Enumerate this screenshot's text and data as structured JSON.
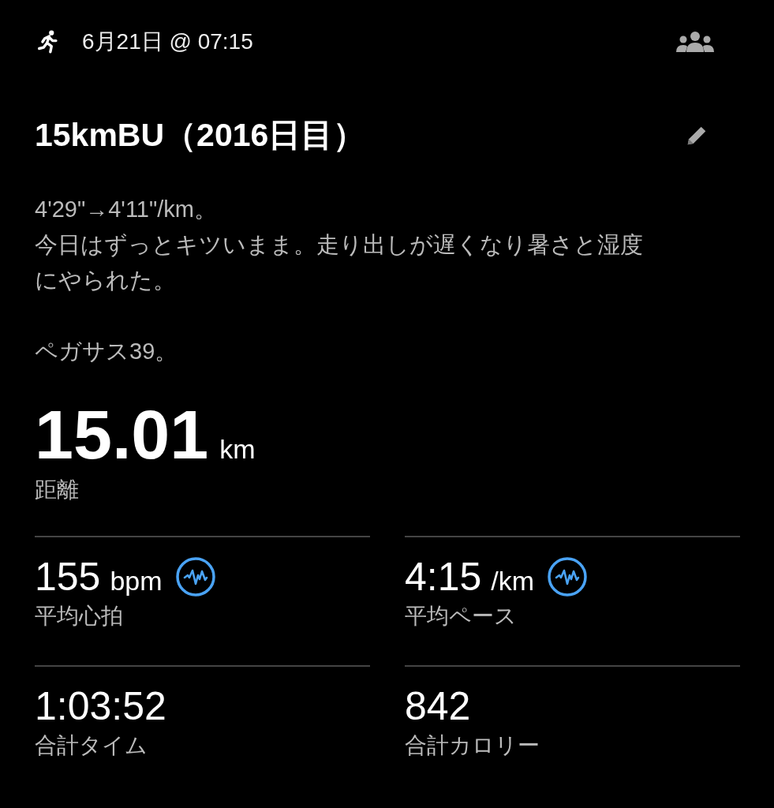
{
  "header": {
    "date": "6月21日 @ 07:15"
  },
  "title": "15kmBU（2016日目）",
  "description": [
    [
      "4'29\"→4'11\"/km。",
      "今日はずっとキツいまま。走り出しが遅くなり暑さと湿度にやられた。"
    ],
    [
      "ペガサス39。"
    ]
  ],
  "distance": {
    "value": "15.01",
    "unit": "km",
    "label": "距離"
  },
  "stats": [
    {
      "value": "155",
      "unit": "bpm",
      "label": "平均心拍",
      "detail": true
    },
    {
      "value": "4:15",
      "unit": "/km",
      "label": "平均ペース",
      "detail": true
    },
    {
      "value": "1:03:52",
      "label": "合計タイム",
      "detail": false
    },
    {
      "value": "842",
      "label": "合計カロリー",
      "detail": false
    }
  ]
}
